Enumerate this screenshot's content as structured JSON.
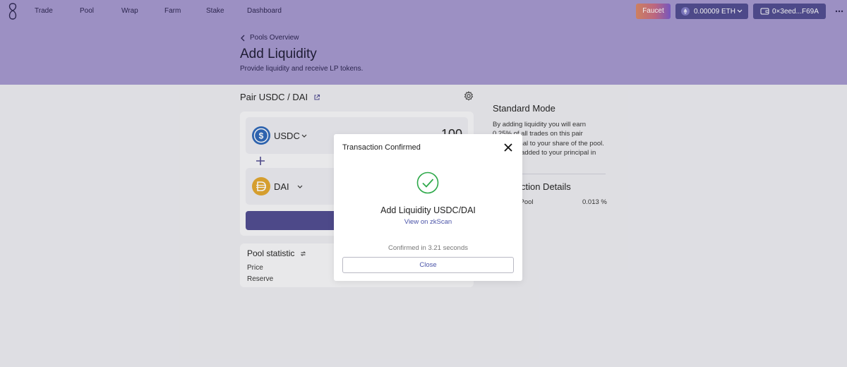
{
  "nav": {
    "items": [
      "Trade",
      "Pool",
      "Wrap",
      "Farm",
      "Stake",
      "Dashboard"
    ],
    "faucet_label": "Faucet",
    "eth_balance": "0.00009",
    "eth_unit": "ETH",
    "wallet_address": "0×3eed...F69A"
  },
  "header": {
    "breadcrumb": "Pools Overview",
    "title": "Add Liquidity",
    "subtitle": "Provide liquidity and receive LP tokens."
  },
  "pair": {
    "title": "Pair USDC / DAI",
    "token_a": {
      "symbol": "USDC",
      "amount": "100"
    },
    "token_b": {
      "symbol": "DAI"
    }
  },
  "stats": {
    "title": "Pool statistic",
    "price_label": "Price",
    "reserve_label": "Reserve"
  },
  "sidebar": {
    "mode_title": "Standard Mode",
    "lines": [
      "By adding liquidity you will earn",
      "0.25% of all trades on this pair",
      "proportional to your share of the pool.",
      "Fees are added to your principal in"
    ],
    "details_title": "Transaction Details",
    "share_label": "Share of Pool",
    "share_value": "0.013 %"
  },
  "modal": {
    "title": "Transaction Confirmed",
    "headline": "Add Liquidity USDC/DAI",
    "link": "View on zkScan",
    "confirmed": "Confirmed in 3.21 seconds",
    "close_label": "Close"
  },
  "colors": {
    "header_bg": "#a497cf",
    "accent": "#4f4a90",
    "success": "#2ea94a",
    "link": "#4a53a8"
  }
}
